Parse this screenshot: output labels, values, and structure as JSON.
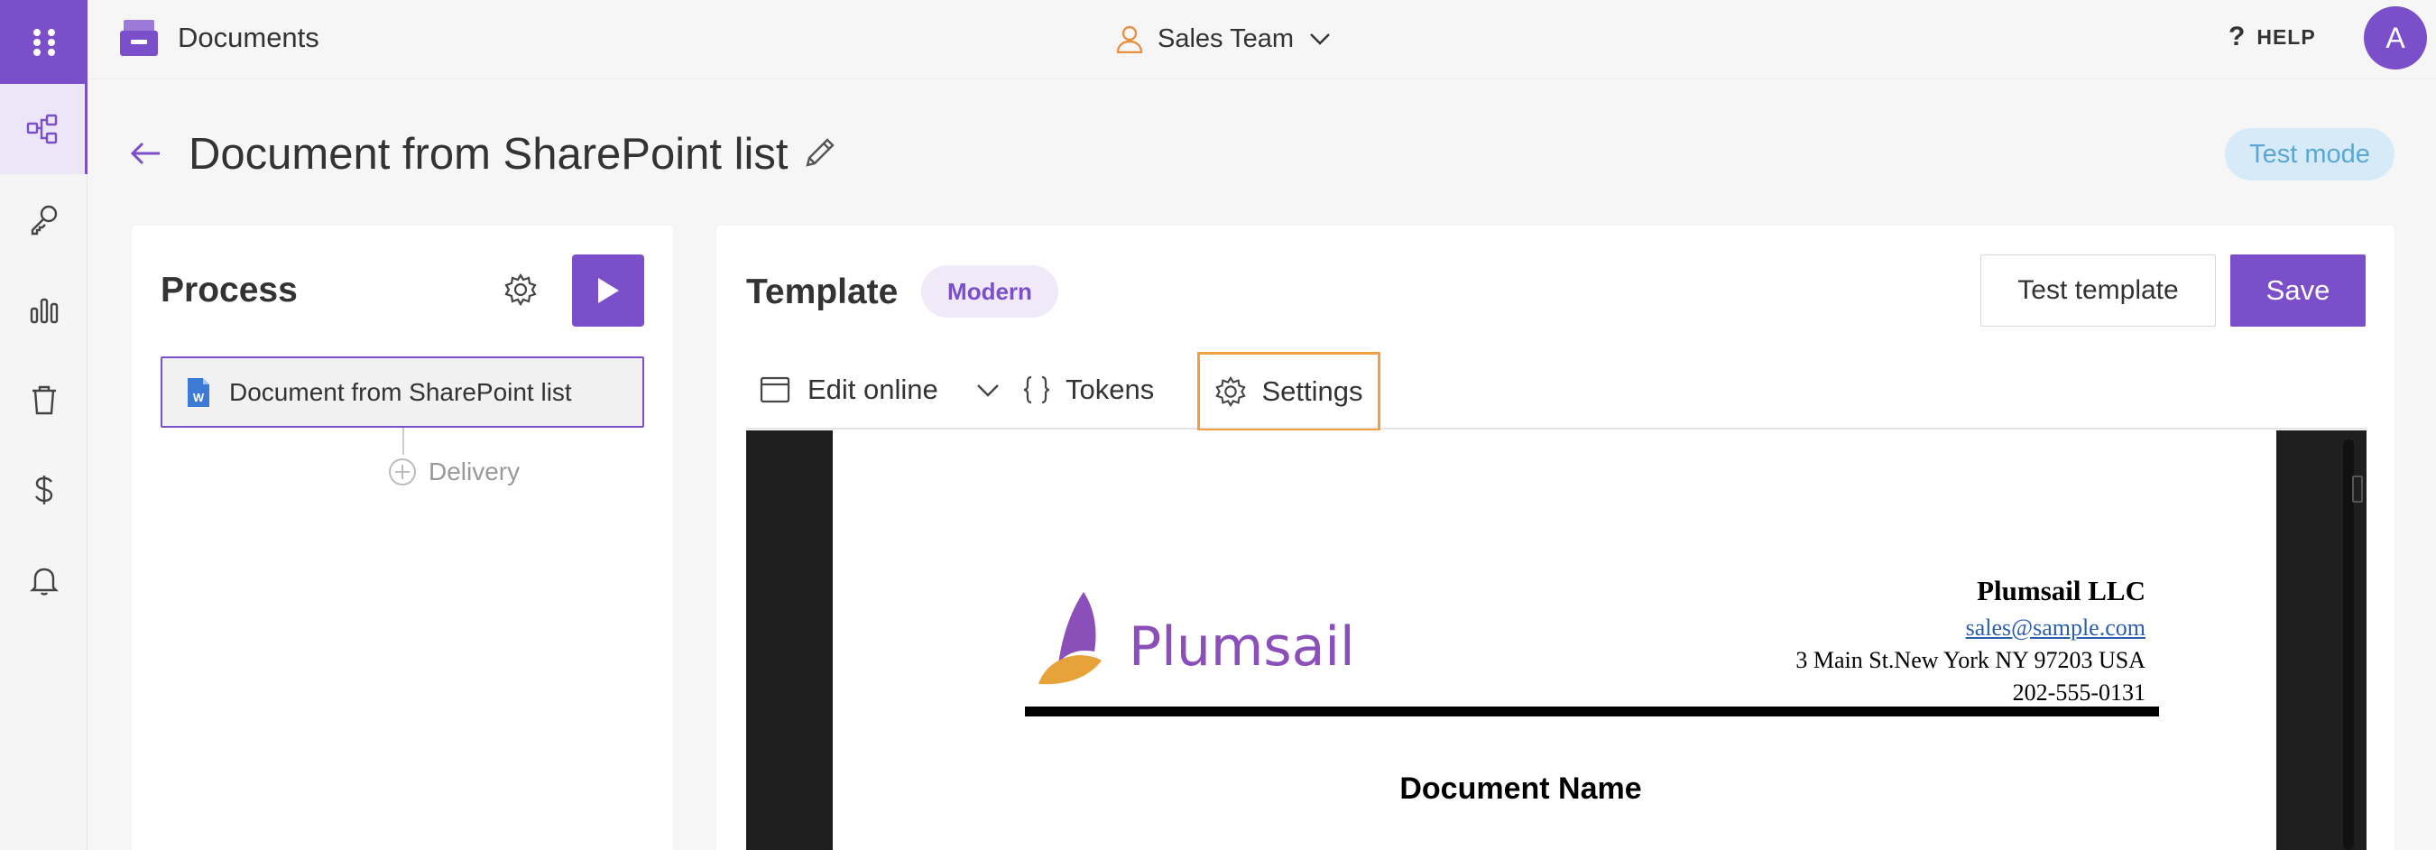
{
  "app": {
    "title": "Documents",
    "team": "Sales Team",
    "help": "HELP",
    "avatar_initial": "A",
    "brand_color": "#7b4fc9"
  },
  "rail": {
    "items": [
      {
        "icon": "grid-menu-icon"
      },
      {
        "icon": "flow-icon",
        "active": true
      },
      {
        "icon": "key-icon"
      },
      {
        "icon": "bar-chart-icon"
      },
      {
        "icon": "trash-icon"
      },
      {
        "icon": "dollar-icon"
      },
      {
        "icon": "bell-icon"
      }
    ]
  },
  "page": {
    "title": "Document from SharePoint list",
    "mode_badge": "Test mode"
  },
  "process": {
    "title": "Process",
    "item_label": "Document from SharePoint list",
    "delivery_label": "Delivery"
  },
  "template": {
    "title": "Template",
    "badge": "Modern",
    "test_button": "Test template",
    "save_button": "Save",
    "tabs": {
      "edit_online": "Edit online",
      "tokens": "Tokens",
      "settings": "Settings"
    }
  },
  "document": {
    "logo_text": "Plumsail",
    "company_name": "Plumsail LLC",
    "email": "sales@sample.com",
    "address": "3 Main St.New York NY 97203 USA",
    "phone": "202-555-0131",
    "heading": "Document Name"
  }
}
